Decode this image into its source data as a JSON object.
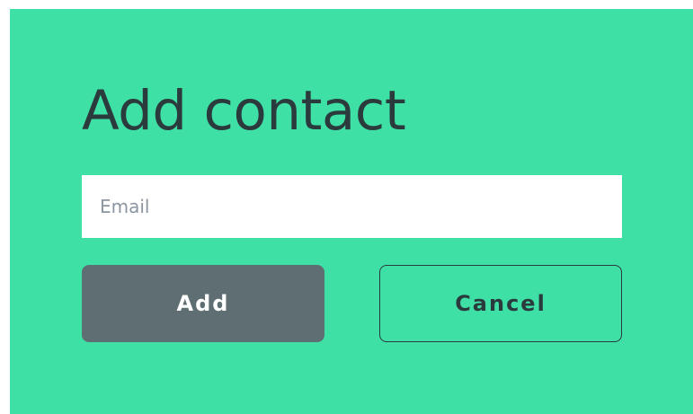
{
  "dialog": {
    "title": "Add contact",
    "email": {
      "value": "",
      "placeholder": "Email"
    },
    "buttons": {
      "add_label": "Add",
      "cancel_label": "Cancel"
    }
  },
  "colors": {
    "background": "#3ee0a6",
    "text": "#2b3a3c",
    "add_button": "#5f6e72",
    "input_background": "#ffffff"
  }
}
